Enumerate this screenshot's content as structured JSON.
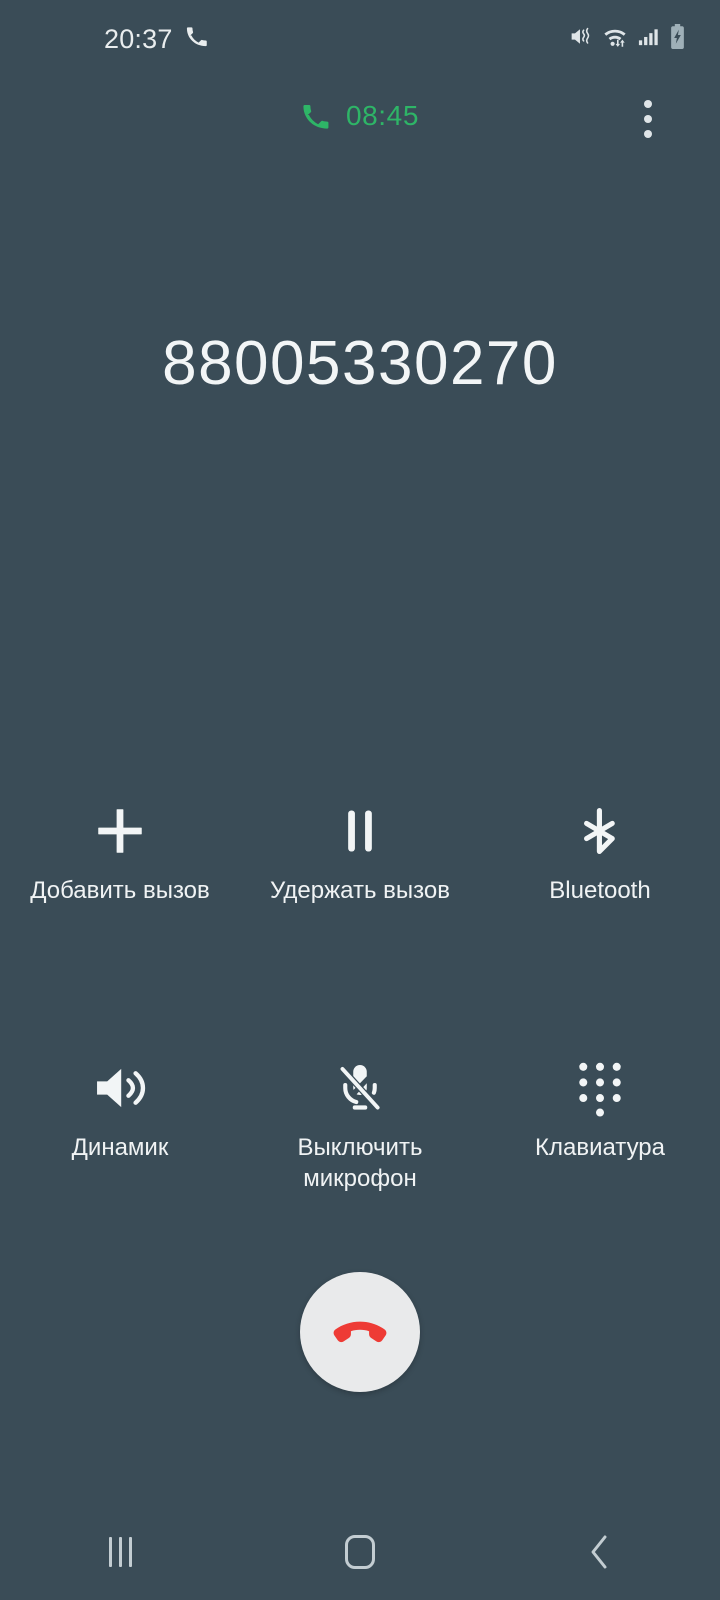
{
  "theme": {
    "background": "#3a4c57",
    "accent_green": "#2eb567",
    "text_primary": "#f2f5f6",
    "endcall_circle": "#e9eaeb",
    "endcall_handset": "#ee3b35",
    "nav_icon": "#c3cdd2"
  },
  "status_bar": {
    "clock": "20:37",
    "left_icons": [
      {
        "name": "phone-call-active-icon"
      }
    ],
    "right_icons": [
      {
        "name": "vibrate-mute-icon"
      },
      {
        "name": "wifi-data-transfer-icon"
      },
      {
        "name": "cellular-signal-icon"
      },
      {
        "name": "battery-charging-icon"
      }
    ]
  },
  "call_header": {
    "timer": "08:45",
    "timer_icon": "phone-handset-icon",
    "overflow_menu_label": "more-options"
  },
  "caller": {
    "number": "88005330270"
  },
  "controls": {
    "rows": [
      [
        {
          "id": "add-call",
          "icon": "plus-icon",
          "label": "Добавить вызов"
        },
        {
          "id": "hold-call",
          "icon": "pause-icon",
          "label": "Удержать вызов"
        },
        {
          "id": "bluetooth",
          "icon": "bluetooth-icon",
          "label": "Bluetooth"
        }
      ],
      [
        {
          "id": "speaker",
          "icon": "speaker-icon",
          "label": "Динамик"
        },
        {
          "id": "mute-mic",
          "icon": "microphone-off-icon",
          "label": "Выключить микрофон"
        },
        {
          "id": "keypad",
          "icon": "dialpad-icon",
          "label": "Клавиатура"
        }
      ]
    ]
  },
  "end_call": {
    "icon": "end-call-handset-icon",
    "label": "Завершить вызов"
  },
  "nav_bar": {
    "buttons": [
      {
        "id": "recents",
        "icon": "recents-icon"
      },
      {
        "id": "home",
        "icon": "home-icon"
      },
      {
        "id": "back",
        "icon": "back-chevron-icon"
      }
    ]
  }
}
